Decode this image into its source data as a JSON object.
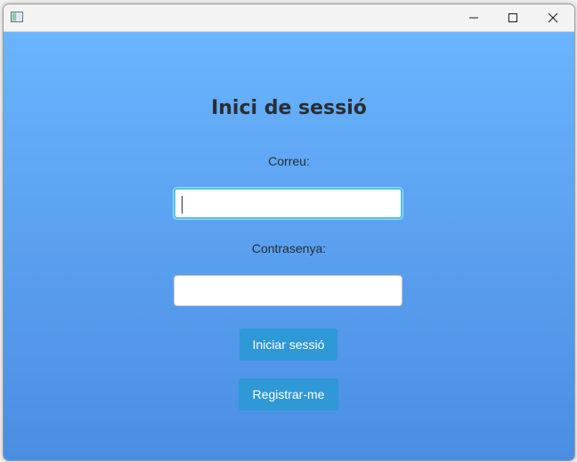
{
  "window": {
    "icon": "app-window-icon",
    "controls": [
      "minimize-icon",
      "maximize-icon",
      "close-icon"
    ]
  },
  "login": {
    "title": "Inici de sessió",
    "email_label": "Correu:",
    "email_value": "",
    "password_label": "Contrasenya:",
    "password_value": "",
    "login_button": "Iniciar sessió",
    "register_button": "Registrar-me"
  },
  "colors": {
    "background_top": "#6ab4ff",
    "background_bottom": "#4a8ee2",
    "button": "#2f98d6",
    "focus_border": "#56c0e8",
    "title_text": "#2a2d33"
  }
}
